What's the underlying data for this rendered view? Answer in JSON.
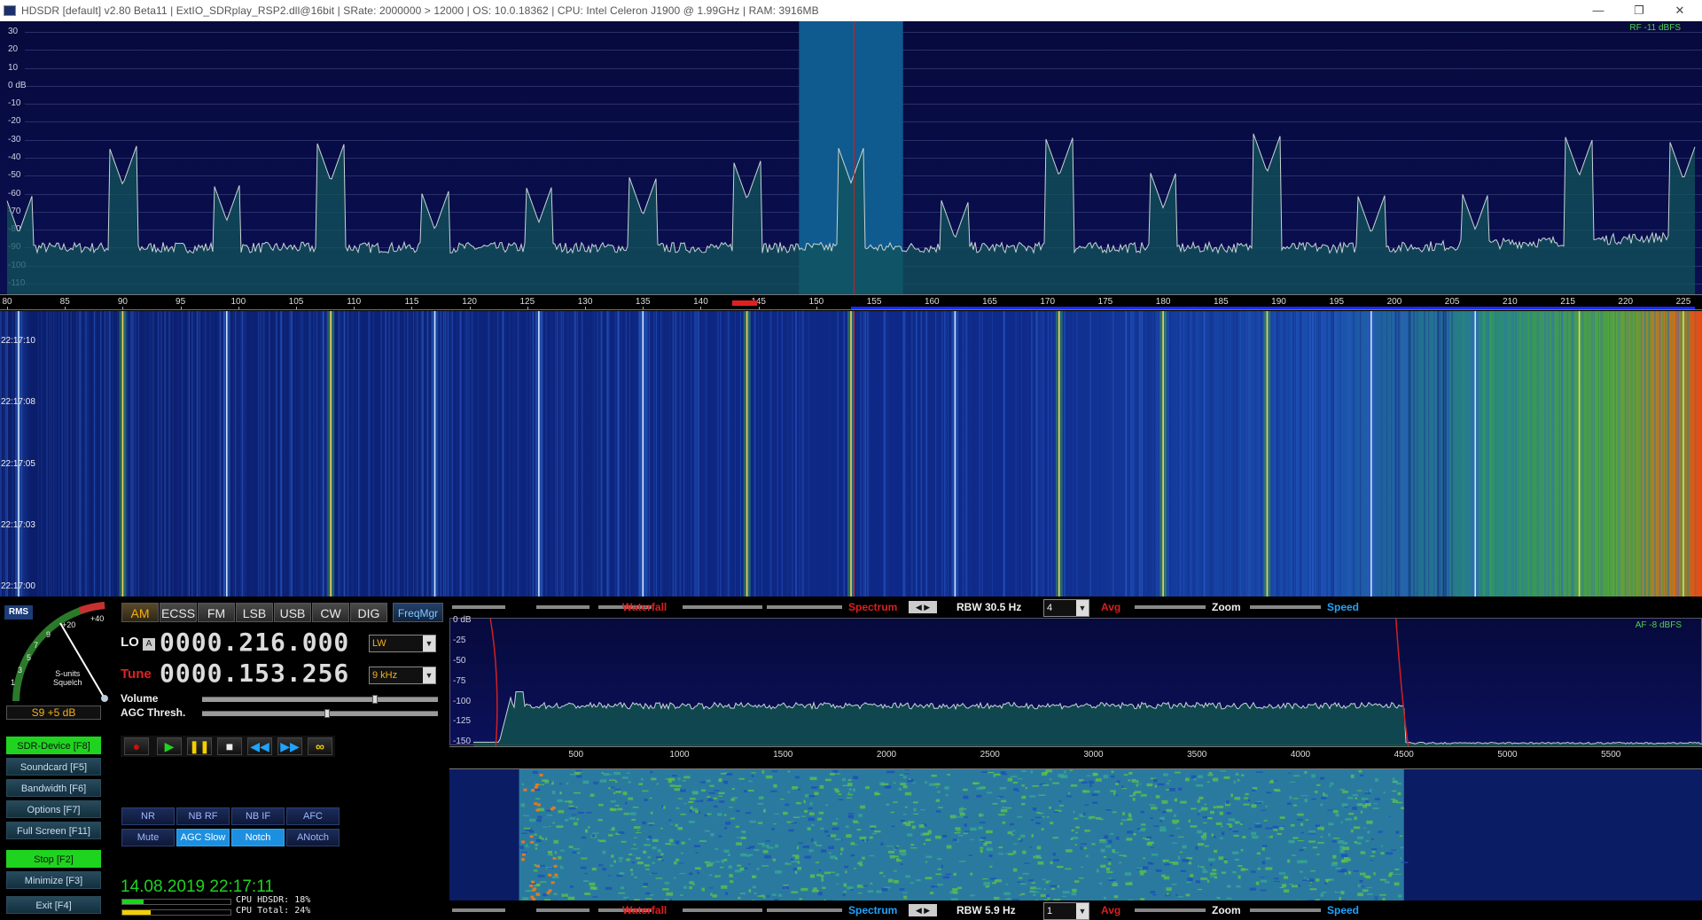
{
  "title_bar": {
    "text": "HDSDR  [default]  v2.80 Beta11  |  ExtIO_SDRplay_RSP2.dll@16bit  |  SRate: 2000000 > 12000  |  OS: 10.0.18362    |  CPU: Intel Celeron  J1900  @ 1.99GHz  |  RAM: 3916MB",
    "minimize": "—",
    "restore": "❐",
    "close": "✕"
  },
  "rf_spectrum": {
    "level_label": "RF -11 dBFS",
    "y_labels": [
      "30",
      "20",
      "10",
      "0 dB",
      "-10",
      "-20",
      "-30",
      "-40",
      "-50",
      "-60",
      "-70",
      "-80",
      "-90",
      "-100",
      "-110"
    ],
    "x_labels": [
      "80",
      "85",
      "90",
      "95",
      "100",
      "105",
      "110",
      "115",
      "120",
      "125",
      "130",
      "135",
      "140",
      "145",
      "150",
      "155",
      "160",
      "165",
      "170",
      "175",
      "180",
      "185",
      "190",
      "195",
      "200",
      "205",
      "210",
      "215",
      "220",
      "225"
    ],
    "x_range": [
      80,
      226
    ],
    "y_range": [
      -116,
      36
    ],
    "peaks_khz": [
      81,
      90,
      99,
      108,
      117,
      126,
      135,
      144,
      153,
      162,
      171,
      180,
      189,
      198,
      207,
      216,
      225
    ],
    "peak_db": [
      -82,
      -55,
      -75,
      -53,
      -80,
      -76,
      -72,
      -63,
      -54,
      -85,
      -50,
      -68,
      -48,
      -82,
      -80,
      -50,
      -52
    ],
    "noise_floor_db": -90,
    "passband_khz": [
      148.5,
      157.5
    ],
    "tune_khz": 153.256
  },
  "waterfall": {
    "time_labels": [
      "22:17:10",
      "22:17:08",
      "22:17:05",
      "22:17:03",
      "22:17:00"
    ]
  },
  "smeter": {
    "rms": "RMS",
    "scale": [
      "1",
      "3",
      "5",
      "7",
      "9",
      "+20",
      "+40"
    ],
    "units": "S-units",
    "squelch": "Squelch",
    "reading": "S9 +5 dB"
  },
  "modes": [
    "AM",
    "ECSS",
    "FM",
    "LSB",
    "USB",
    "CW",
    "DIG"
  ],
  "active_mode": "AM",
  "freqmgr": "FreqMgr",
  "lo": {
    "label": "LO",
    "lock": "A",
    "value": "0000.216.000",
    "band": "LW"
  },
  "tune": {
    "label": "Tune",
    "value": "0000.153.256",
    "step": "9 kHz"
  },
  "volume_label": "Volume",
  "agc_label": "AGC Thresh.",
  "volume_level": 0.74,
  "agc_level": 0.53,
  "left_buttons": [
    {
      "label": "SDR-Device [F8]",
      "active": true
    },
    {
      "label": "Soundcard [F5]",
      "active": false
    },
    {
      "label": "Bandwidth [F6]",
      "active": false
    },
    {
      "label": "Options [F7]",
      "active": false
    },
    {
      "label": "Full Screen [F11]",
      "active": false
    },
    {
      "label": "Stop [F2]",
      "active": true
    },
    {
      "label": "Minimize [F3]",
      "active": false
    },
    {
      "label": "Exit [F4]",
      "active": false
    }
  ],
  "dsp_row1": [
    {
      "label": "NR",
      "active": false
    },
    {
      "label": "NB RF",
      "active": false
    },
    {
      "label": "NB IF",
      "active": false
    },
    {
      "label": "AFC",
      "active": false
    }
  ],
  "dsp_row2": [
    {
      "label": "Mute",
      "active": false
    },
    {
      "label": "AGC Slow",
      "active": true
    },
    {
      "label": "Notch",
      "active": true
    },
    {
      "label": "ANotch",
      "active": false
    }
  ],
  "datetime": "14.08.2019 22:17:11",
  "cpu": {
    "hdsdr_label": "CPU HDSDR:",
    "hdsdr_value": "18%",
    "total_label": "CPU Total:",
    "total_value": "24%",
    "hdsdr_fraction": 0.18,
    "total_fraction": 0.24
  },
  "strip_labels": {
    "waterfall": "Waterfall",
    "spectrum": "Spectrum",
    "avg": "Avg",
    "zoom": "Zoom",
    "speed": "Speed"
  },
  "top_strip": {
    "rbw": "RBW 30.5 Hz",
    "avg_value": "4"
  },
  "bottom_strip": {
    "rbw": "RBW  5.9 Hz",
    "avg_value": "1"
  },
  "af_spectrum": {
    "level_label": "AF  -8 dBFS",
    "y_labels": [
      "0 dB",
      "-25",
      "-50",
      "-75",
      "-100",
      "-125",
      "-150"
    ],
    "x_labels": [
      "500",
      "1000",
      "1500",
      "2000",
      "2500",
      "3000",
      "3500",
      "4000",
      "4500",
      "5000",
      "5500"
    ],
    "x_range": [
      0,
      5940
    ],
    "y_range": [
      -155,
      2
    ],
    "passband_hz": [
      125,
      4500
    ],
    "noise_level_db": -105
  }
}
